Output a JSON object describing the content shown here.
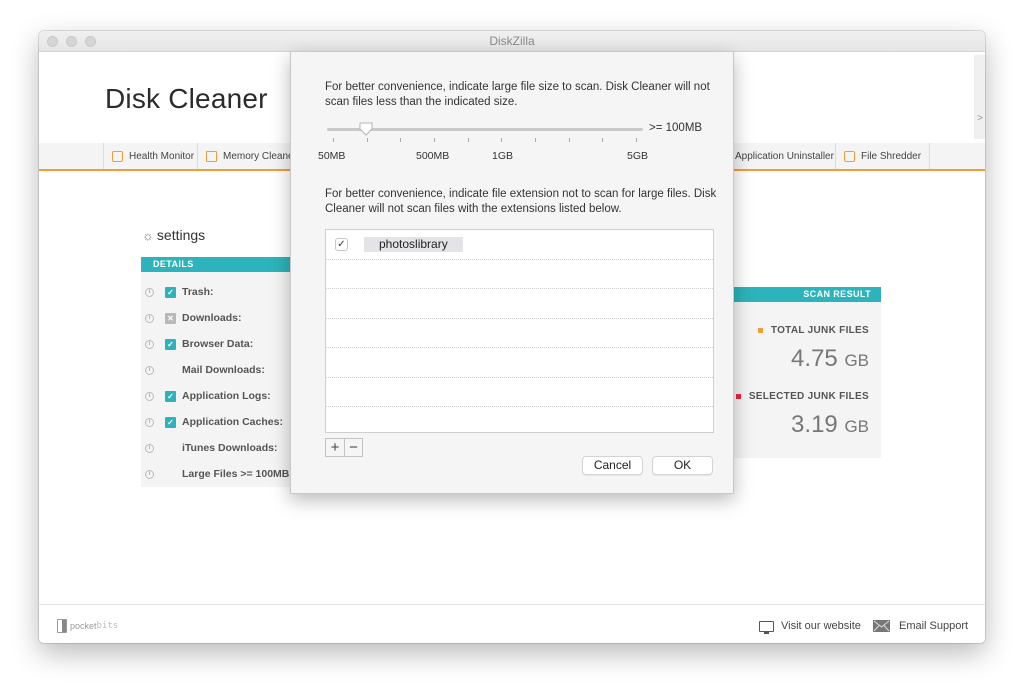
{
  "window": {
    "title": "DiskZilla"
  },
  "app": {
    "title": "Disk Cleaner"
  },
  "tabs": [
    {
      "label": "Health Monitor",
      "icon": "list-icon"
    },
    {
      "label": "Memory Cleaner",
      "icon": "monitor-icon"
    },
    {
      "label": "Application Uninstaller",
      "icon": ""
    },
    {
      "label": "File Shredder",
      "icon": "trash-icon"
    }
  ],
  "settings": {
    "title": "settings",
    "details_header": "DETAILS",
    "items": [
      {
        "label": "Trash:",
        "state": "checked"
      },
      {
        "label": "Downloads:",
        "state": "disabled"
      },
      {
        "label": "Browser Data:",
        "state": "checked"
      },
      {
        "label": "Mail Downloads:",
        "state": "none"
      },
      {
        "label": "Application Logs:",
        "state": "checked"
      },
      {
        "label": "Application Caches:",
        "state": "checked"
      },
      {
        "label": "iTunes Downloads:",
        "state": "none"
      },
      {
        "label": "Large Files >= 100MB:",
        "state": "none"
      }
    ]
  },
  "scan_result": {
    "header": "SCAN RESULT",
    "total_label": "TOTAL JUNK FILES",
    "total_value": "4.75",
    "total_unit": "GB",
    "selected_label": "SELECTED JUNK FILES",
    "selected_value": "3.19",
    "selected_unit": "GB",
    "colors": {
      "total": "#f29d38",
      "selected": "#e8283c"
    }
  },
  "dialog": {
    "size_description": "For better convenience, indicate large file size to scan. Disk Cleaner will not scan files less than the indicated size.",
    "slider_value_text": ">=  100MB",
    "slider_position_fraction": 0.11,
    "tick_labels": [
      "50MB",
      "500MB",
      "1GB",
      "5GB"
    ],
    "extension_description": "For better convenience, indicate file extension not to scan for large files. Disk Cleaner will not scan files with the extensions listed below.",
    "extensions": [
      {
        "name": "photoslibrary",
        "checked": true
      }
    ],
    "add_label": "+",
    "remove_label": "−",
    "cancel_label": "Cancel",
    "ok_label": "OK"
  },
  "footer": {
    "brand_a": "pocket",
    "brand_b": "bits",
    "visit_label": "Visit our website",
    "email_label": "Email Support"
  },
  "colors": {
    "accent_teal": "#2db3bb",
    "accent_orange": "#f29d38"
  }
}
